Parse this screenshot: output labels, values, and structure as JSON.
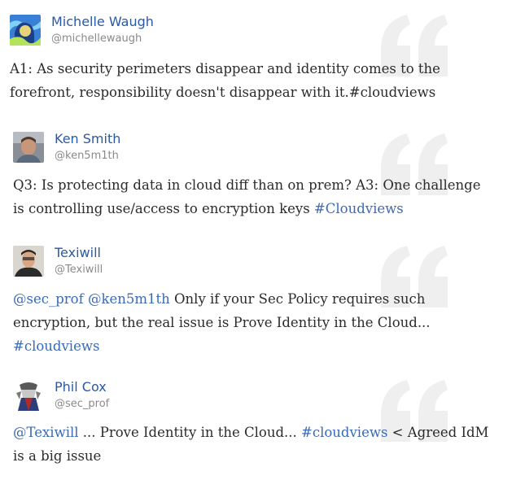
{
  "colors": {
    "name": "#2a5aa6",
    "link": "#3b6ab5",
    "handle": "#8a8a8a",
    "text": "#2b2b2b",
    "quote_mark": "#efefef"
  },
  "tweets": [
    {
      "avatar_icon": "michelle-avatar-icon",
      "name": "Michelle Waugh",
      "handle": "@michellewaugh",
      "segments": [
        {
          "text": "A1: As security perimeters disappear and identity comes to the forefront, responsibility doesn't disappear with it.#cloudviews",
          "link": false
        }
      ]
    },
    {
      "avatar_icon": "ken-avatar-icon",
      "name": "Ken Smith",
      "handle": "@ken5m1th",
      "segments": [
        {
          "text": "Q3: Is protecting data in cloud diff than on prem? A3: One challenge is controlling use/access to encryption keys ",
          "link": false
        },
        {
          "text": "#Cloudviews",
          "link": true
        }
      ]
    },
    {
      "avatar_icon": "texiwill-avatar-icon",
      "name": "Texiwill",
      "handle": "@Texiwill",
      "segments": [
        {
          "text": "@sec_prof",
          "link": true
        },
        {
          "text": " ",
          "link": false
        },
        {
          "text": "@ken5m1th",
          "link": true
        },
        {
          "text": " Only if your Sec Policy requires such encryption, but the real issue is Prove Identity in the Cloud... ",
          "link": false
        },
        {
          "text": "#cloudviews",
          "link": true
        }
      ]
    },
    {
      "avatar_icon": "phil-avatar-icon",
      "name": "Phil Cox",
      "handle": "@sec_prof",
      "segments": [
        {
          "text": "@Texiwill",
          "link": true
        },
        {
          "text": " ... Prove Identity in the Cloud... ",
          "link": false
        },
        {
          "text": "#cloudviews",
          "link": true
        },
        {
          "text": " < Agreed IdM is a big issue",
          "link": false
        }
      ]
    }
  ]
}
